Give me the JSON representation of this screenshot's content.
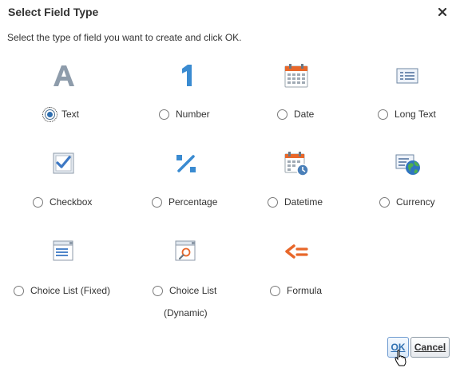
{
  "dialog": {
    "title": "Select Field Type",
    "instruction": "Select the type of field you want to create and click OK."
  },
  "options": [
    {
      "label": "Text",
      "icon": "text-letter-a-icon",
      "selected": true
    },
    {
      "label": "Number",
      "icon": "number-one-icon",
      "selected": false
    },
    {
      "label": "Date",
      "icon": "calendar-icon",
      "selected": false
    },
    {
      "label": "Long Text",
      "icon": "long-text-icon",
      "selected": false
    },
    {
      "label": "Checkbox",
      "icon": "checkbox-icon",
      "selected": false
    },
    {
      "label": "Percentage",
      "icon": "percent-icon",
      "selected": false
    },
    {
      "label": "Datetime",
      "icon": "calendar-clock-icon",
      "selected": false
    },
    {
      "label": "Currency",
      "icon": "currency-globe-icon",
      "selected": false
    },
    {
      "label": "Choice List (Fixed)",
      "icon": "fixed-list-icon",
      "selected": false
    },
    {
      "label": "Choice List",
      "label_line2": "(Dynamic)",
      "icon": "dynamic-list-icon",
      "selected": false
    },
    {
      "label": "Formula",
      "icon": "formula-icon",
      "selected": false
    }
  ],
  "buttons": {
    "ok": "OK",
    "cancel": "Cancel"
  },
  "colors": {
    "accent_blue": "#2f6fb1",
    "icon_orange": "#e8672a",
    "icon_gray": "#8a9aaa"
  }
}
